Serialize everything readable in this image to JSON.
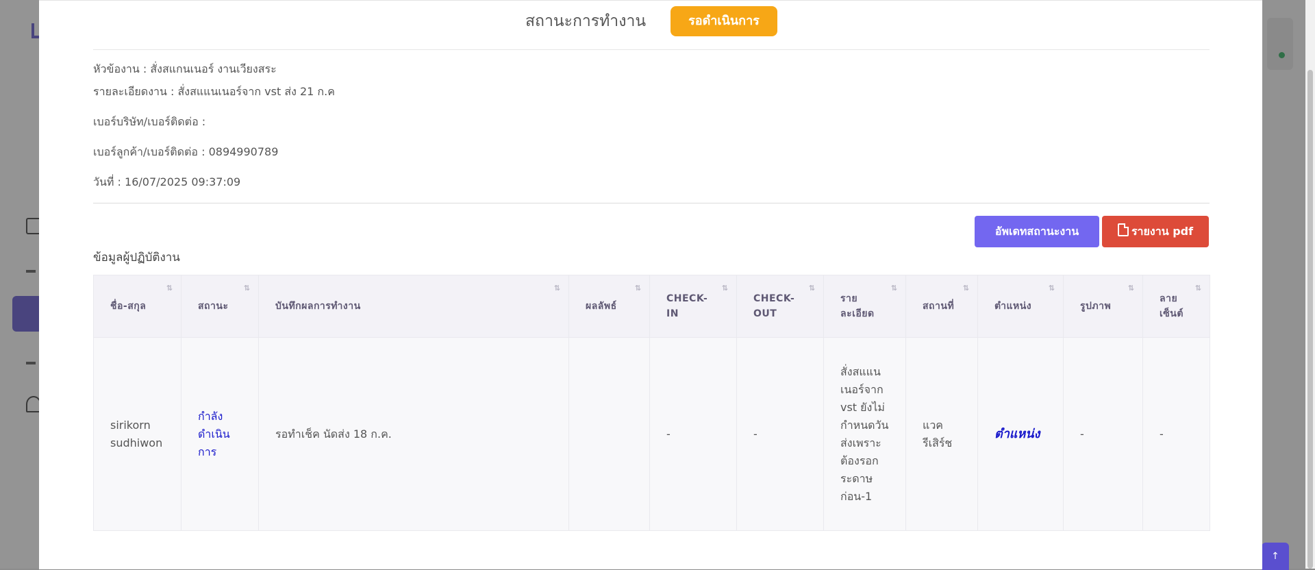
{
  "status": {
    "title": "สถานะการทำงาน",
    "badge": "รอดำเนินการ",
    "badge_color": "#f7a716"
  },
  "info": {
    "topic_label": "หัวข้องาน :",
    "topic_value": "สั่งสแกนเนอร์ งานเวียงสระ",
    "detail_label": "รายละเอียดงาน :",
    "detail_value": "สั่งสแแนเนอร์จาก vst ส่ง 21 ก.ค",
    "company_phone_label": "เบอร์บริษัท/เบอร์ติดต่อ :",
    "company_phone_value": "",
    "customer_phone_label": "เบอร์ลูกค้า/เบอร์ติดต่อ :",
    "customer_phone_value": "0894990789",
    "date_label": "วันที่ :",
    "date_value": "16/07/2025 09:37:09"
  },
  "buttons": {
    "update_status": "อัพเดทสถานะงาน",
    "pdf_report": "รายงาน pdf",
    "update_color": "#7367f0",
    "pdf_color": "#dd4b39"
  },
  "section_title": "ข้อมูลผู้ปฏิบัติงาน",
  "table": {
    "columns": [
      "ชื่อ-สกุล",
      "สถานะ",
      "บันทึกผลการทำงาน",
      "ผลลัพธ์",
      "CHECK-IN",
      "CHECK-OUT",
      "รายละเอียด",
      "สถานที่",
      "ตำแหน่ง",
      "รูปภาพ",
      "ลายเซ็นต์"
    ],
    "rows": [
      {
        "name": "sirikorn sudhiwon",
        "status": "กำลังดำเนินการ",
        "log": "รอทำเช็ค นัดส่ง 18 ก.ค.",
        "result": "",
        "check_in": "-",
        "check_out": "-",
        "detail": "สั่งสแแนเนอร์จาก vst ยังไม่กำหนดวันส่งเพราะต้องรอกระดาษก่อน-1",
        "location": "แวค รีเสิร์ช",
        "position": "ตำแหน่ง",
        "image": "-",
        "signature": "-"
      }
    ]
  },
  "icons": {
    "sort": "sort-arrows-icon",
    "pdf": "pdf-file-icon",
    "scroll_top": "arrow-up-icon"
  }
}
